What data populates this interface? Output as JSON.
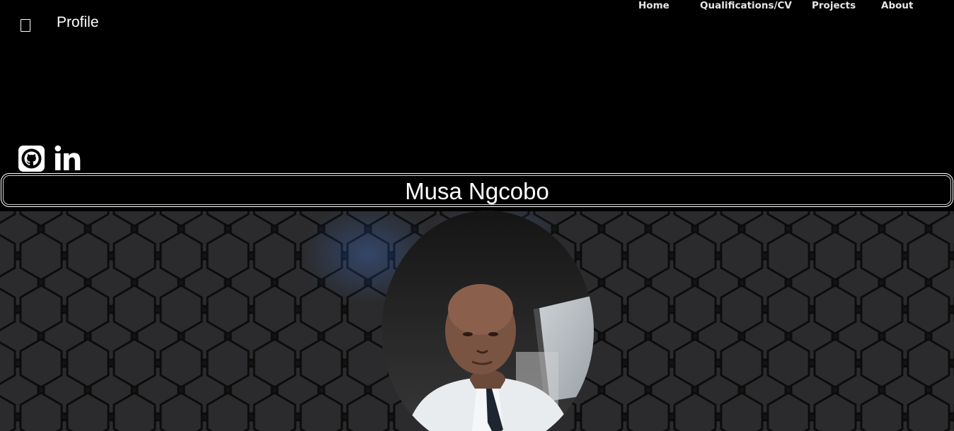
{
  "header": {
    "brand": "Profile",
    "menu_icon": "hamburger-icon",
    "nav": [
      {
        "label": "Home"
      },
      {
        "label": "Qualifications/CV"
      },
      {
        "label": "Projects"
      },
      {
        "label": "About"
      }
    ]
  },
  "socials": [
    {
      "icon": "github-icon"
    },
    {
      "icon": "linkedin-icon"
    }
  ],
  "profile": {
    "name": "Musa Ngcobo",
    "photo": "profile-photo"
  },
  "colors": {
    "background": "#000000",
    "text": "#ffffff",
    "hex_background": "#1b1b1b",
    "hex_tile": "#2b2b2d",
    "hex_glow": "#1f5fd6"
  }
}
